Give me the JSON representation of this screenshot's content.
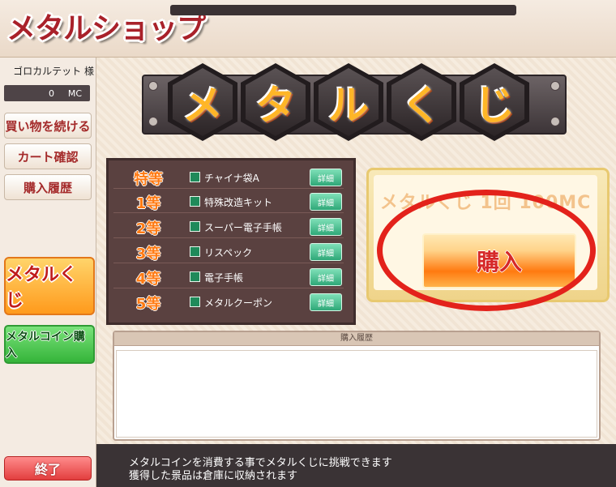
{
  "header": {
    "title": "メタルショップ"
  },
  "sidebar": {
    "user_name": "ゴロカルテット 様",
    "mc_value": "0",
    "mc_unit": "MC",
    "buttons": [
      "買い物を続ける",
      "カート確認",
      "購入履歴"
    ],
    "lottery": "メタルくじ",
    "coin": "メタルコイン購入",
    "end": "終了"
  },
  "banner": {
    "chars": [
      "メ",
      "タ",
      "ル",
      "く",
      "じ"
    ]
  },
  "prizes": [
    {
      "rank": "特等",
      "item": "チャイナ袋A",
      "button": "詳細"
    },
    {
      "rank": "1等",
      "item": "特殊改造キット",
      "button": "詳細"
    },
    {
      "rank": "2等",
      "item": "スーパー電子手帳",
      "button": "詳細"
    },
    {
      "rank": "3等",
      "item": "リスペック",
      "button": "詳細"
    },
    {
      "rank": "4等",
      "item": "電子手帳",
      "button": "詳細"
    },
    {
      "rank": "5等",
      "item": "メタルクーポン",
      "button": "詳細"
    }
  ],
  "purchase": {
    "price_text": "メタルくじ 1回 100MC",
    "button": "購入"
  },
  "history": {
    "title": "購入履歴"
  },
  "footer": {
    "line1": "メタルコインを消費する事でメタルくじに挑戦できます",
    "line2": "獲得した景品は倉庫に収納されます"
  },
  "colors": {
    "accent_red": "#e3221b",
    "title_red": "#a9212a"
  }
}
